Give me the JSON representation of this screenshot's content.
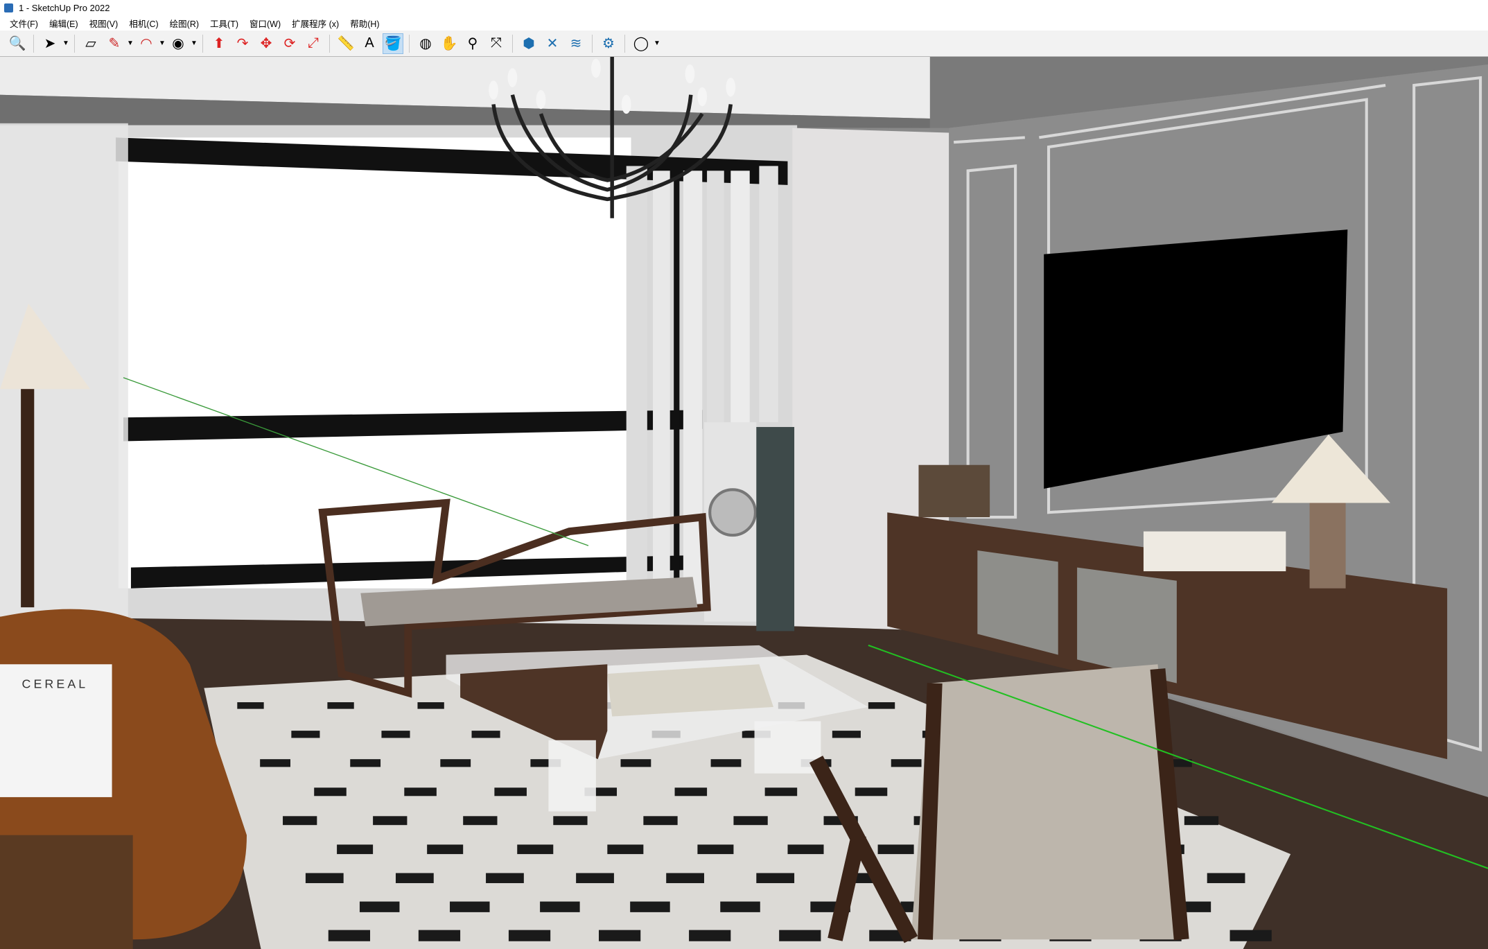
{
  "window": {
    "title": "1 - SketchUp Pro 2022"
  },
  "menu": [
    "文件(F)",
    "编辑(E)",
    "视图(V)",
    "相机(C)",
    "绘图(R)",
    "工具(T)",
    "窗口(W)",
    "扩展程序 (x)",
    "帮助(H)"
  ],
  "toolbar": [
    {
      "name": "zoom-window",
      "icon": "magnifier"
    },
    {
      "sep": true
    },
    {
      "name": "select",
      "icon": "arrow",
      "dropdown": true
    },
    {
      "sep": true
    },
    {
      "name": "eraser",
      "icon": "eraser"
    },
    {
      "name": "line",
      "icon": "pencil",
      "dropdown": true
    },
    {
      "name": "arc",
      "icon": "arc",
      "dropdown": true
    },
    {
      "name": "circle",
      "icon": "circle",
      "dropdown": true
    },
    {
      "sep": true
    },
    {
      "name": "push-pull",
      "icon": "pushpull"
    },
    {
      "name": "follow-me",
      "icon": "followme"
    },
    {
      "name": "move",
      "icon": "move"
    },
    {
      "name": "rotate",
      "icon": "rotate"
    },
    {
      "name": "scale",
      "icon": "scale"
    },
    {
      "sep": true
    },
    {
      "name": "tape-measure",
      "icon": "tape"
    },
    {
      "name": "text",
      "icon": "text"
    },
    {
      "name": "paint-bucket",
      "icon": "paint",
      "active": true
    },
    {
      "sep": true
    },
    {
      "name": "orbit",
      "icon": "orbit"
    },
    {
      "name": "pan",
      "icon": "hand"
    },
    {
      "name": "zoom",
      "icon": "zoom"
    },
    {
      "name": "zoom-extents",
      "icon": "extents"
    },
    {
      "sep": true
    },
    {
      "name": "warehouse",
      "icon": "warehouse"
    },
    {
      "name": "extension-warehouse",
      "icon": "ext"
    },
    {
      "name": "sketchup-layout",
      "icon": "layout"
    },
    {
      "sep": true
    },
    {
      "name": "extension-manager",
      "icon": "extmgr"
    },
    {
      "sep": true
    },
    {
      "name": "account",
      "icon": "user",
      "dropdown": true
    }
  ],
  "scene": {
    "magazine_title": "CEREAL",
    "colors": {
      "wall": "#8a8a8a",
      "floor": "#3f3028",
      "wood": "#4e3426",
      "rug": "#dcdad6",
      "tv": "#000000"
    }
  }
}
